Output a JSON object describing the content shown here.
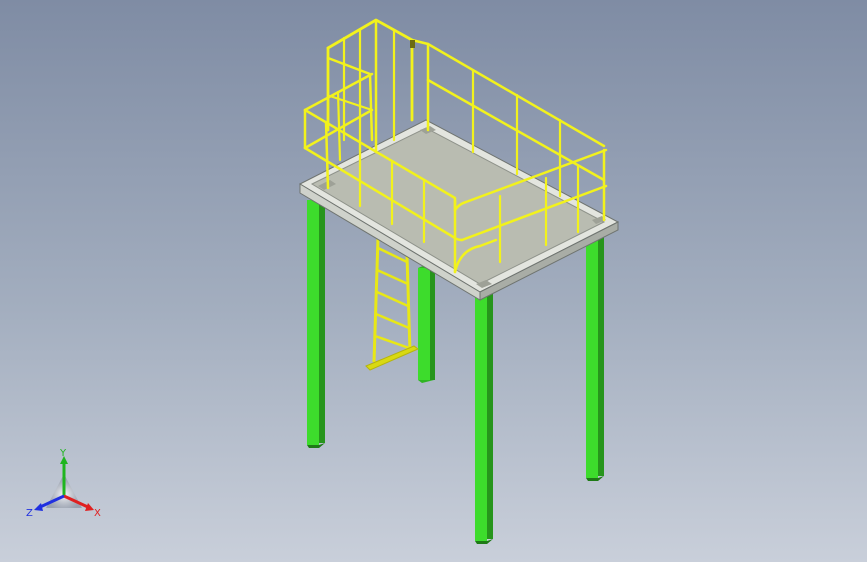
{
  "viewport": {
    "background_top": "#7f8ca4",
    "background_bottom": "#c9cfda"
  },
  "model": {
    "parts": [
      {
        "name": "support-legs",
        "color": "#39d12a"
      },
      {
        "name": "deck-plate",
        "color": "#b9bcb1"
      },
      {
        "name": "deck-frame",
        "color": "#d7d9d3"
      },
      {
        "name": "guard-railing",
        "color": "#f2f21c"
      },
      {
        "name": "access-ladder",
        "color": "#f2f21c"
      }
    ]
  },
  "triad": {
    "x_label": "X",
    "y_label": "Y",
    "z_label": "Z",
    "x_color": "#e02020",
    "y_color": "#1fb51f",
    "z_color": "#2030e0"
  }
}
